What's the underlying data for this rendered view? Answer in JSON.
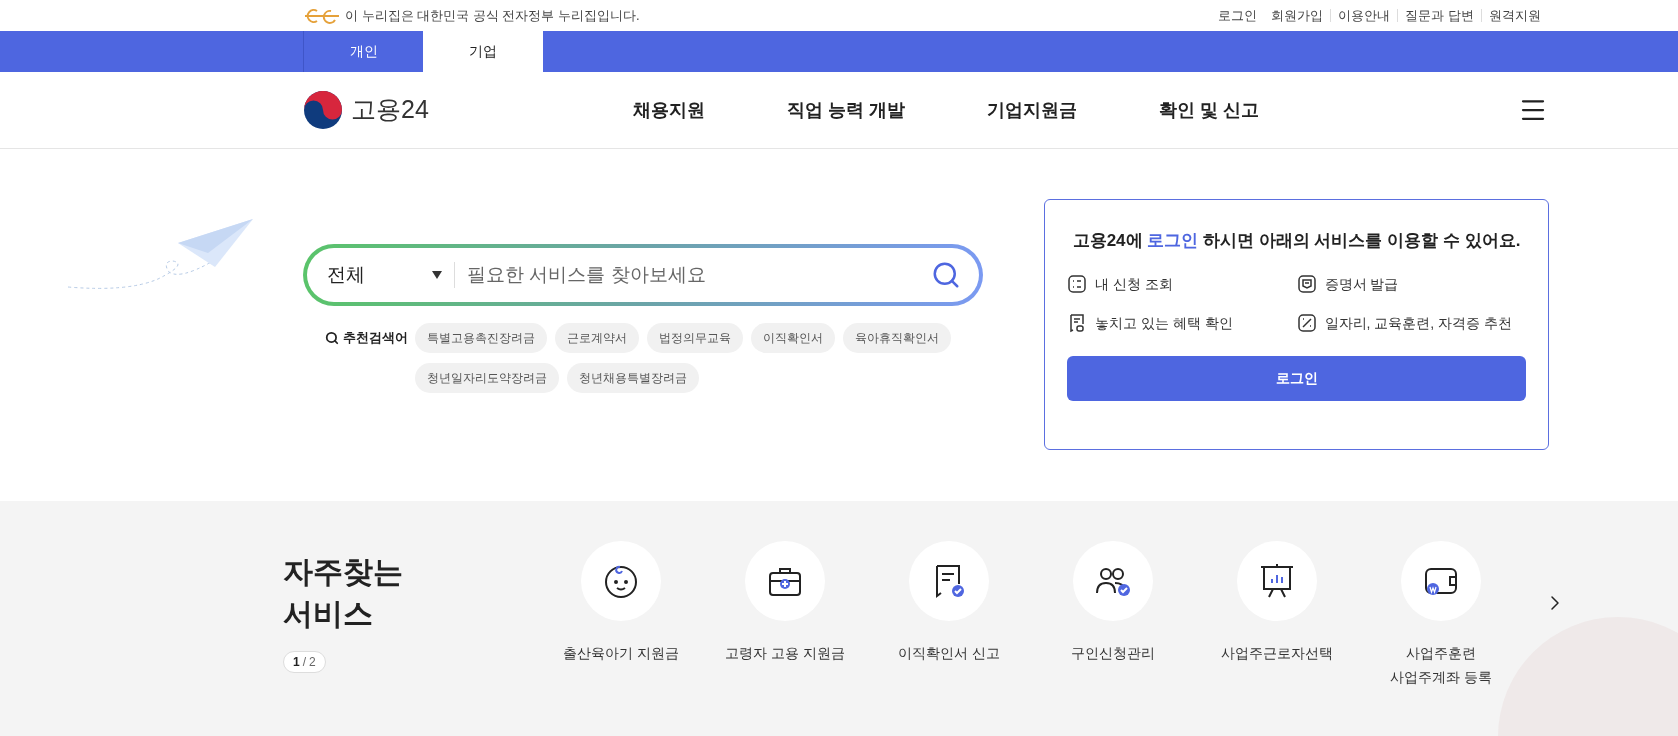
{
  "gov_banner": {
    "text": "이 누리집은 대한민국 공식 전자정부 누리집입니다.",
    "links": [
      "로그인",
      "회원가입",
      "이용안내",
      "질문과 답변",
      "원격지원"
    ]
  },
  "user_tabs": [
    {
      "label": "개인",
      "selected": false
    },
    {
      "label": "기업",
      "selected": true
    }
  ],
  "header": {
    "logo_text": "고용24",
    "nav": [
      "채용지원",
      "직업 능력 개발",
      "기업지원금",
      "확인 및 신고"
    ]
  },
  "search": {
    "category": "전체",
    "placeholder": "필요한 서비스를 찾아보세요",
    "recommend_label": "추천검색어",
    "tags": [
      "특별고용촉진장려금",
      "근로계약서",
      "법정의무교육",
      "이직확인서",
      "육아휴직확인서",
      "청년일자리도약장려금",
      "청년채용특별장려금"
    ]
  },
  "login_box": {
    "heading_before": "고용24에",
    "heading_link": "로그인",
    "heading_after": "하시면 아래의 서비스를 이용할 수 있어요.",
    "features": [
      {
        "kind": "list",
        "label": "내 신청 조회"
      },
      {
        "kind": "certificate",
        "label": "증명서 발급"
      },
      {
        "kind": "receipt",
        "label": "놓치고 있는 혜택 확인"
      },
      {
        "kind": "wand",
        "label": "일자리, 교육훈련, 자격증 추천"
      }
    ],
    "button": "로그인"
  },
  "frequent_services": {
    "title_lines": [
      "자주찾는",
      "서비스"
    ],
    "pager": {
      "current": "1",
      "separator": "/",
      "total": "2"
    },
    "items": [
      {
        "kind": "baby",
        "lines": [
          "출산육아기 지원금"
        ]
      },
      {
        "kind": "briefcase",
        "lines": [
          "고령자 고용 지원금"
        ]
      },
      {
        "kind": "document",
        "lines": [
          "이직확인서 신고"
        ]
      },
      {
        "kind": "people",
        "lines": [
          "구인신청관리"
        ]
      },
      {
        "kind": "board",
        "lines": [
          "사업주근로자선택"
        ]
      },
      {
        "kind": "wallet",
        "lines": [
          "사업주훈련",
          "사업주계좌 등록"
        ]
      }
    ]
  }
}
